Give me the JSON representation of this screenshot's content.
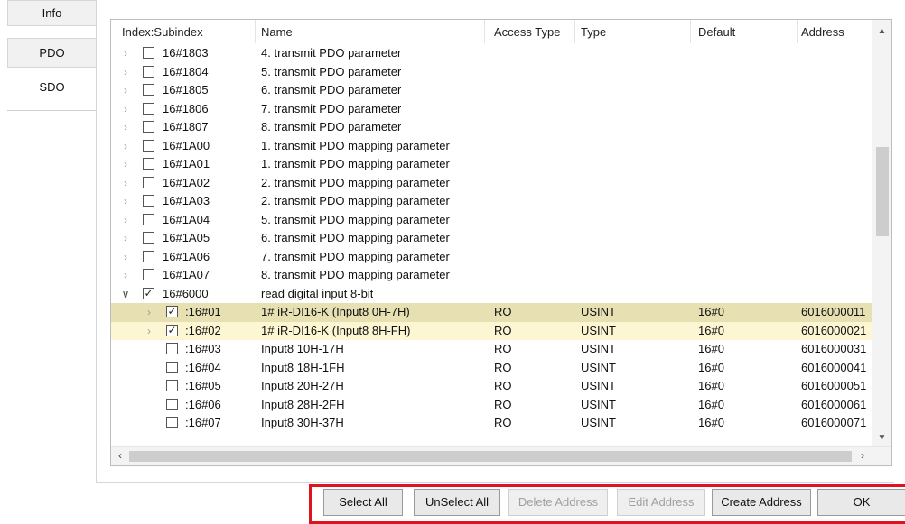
{
  "side_tabs": {
    "info": "Info",
    "pdo": "PDO",
    "sdo": "SDO"
  },
  "columns": {
    "index": "Index:Subindex",
    "name": "Name",
    "access": "Access Type",
    "type": "Type",
    "default": "Default",
    "address": "Address"
  },
  "rows": [
    {
      "index": "16#1803",
      "name": "4. transmit PDO parameter",
      "access": "",
      "type": "",
      "default": "",
      "address": ""
    },
    {
      "index": "16#1804",
      "name": "5. transmit PDO parameter",
      "access": "",
      "type": "",
      "default": "",
      "address": ""
    },
    {
      "index": "16#1805",
      "name": "6. transmit PDO parameter",
      "access": "",
      "type": "",
      "default": "",
      "address": ""
    },
    {
      "index": "16#1806",
      "name": "7. transmit PDO parameter",
      "access": "",
      "type": "",
      "default": "",
      "address": ""
    },
    {
      "index": "16#1807",
      "name": "8. transmit PDO parameter",
      "access": "",
      "type": "",
      "default": "",
      "address": ""
    },
    {
      "index": "16#1A00",
      "name": "1. transmit PDO mapping parameter",
      "access": "",
      "type": "",
      "default": "",
      "address": ""
    },
    {
      "index": "16#1A01",
      "name": "1. transmit PDO mapping parameter",
      "access": "",
      "type": "",
      "default": "",
      "address": ""
    },
    {
      "index": "16#1A02",
      "name": "2. transmit PDO mapping parameter",
      "access": "",
      "type": "",
      "default": "",
      "address": ""
    },
    {
      "index": "16#1A03",
      "name": "2. transmit PDO mapping parameter",
      "access": "",
      "type": "",
      "default": "",
      "address": ""
    },
    {
      "index": "16#1A04",
      "name": "5. transmit PDO mapping parameter",
      "access": "",
      "type": "",
      "default": "",
      "address": ""
    },
    {
      "index": "16#1A05",
      "name": "6. transmit PDO mapping parameter",
      "access": "",
      "type": "",
      "default": "",
      "address": ""
    },
    {
      "index": "16#1A06",
      "name": "7. transmit PDO mapping parameter",
      "access": "",
      "type": "",
      "default": "",
      "address": ""
    },
    {
      "index": "16#1A07",
      "name": "8. transmit PDO mapping parameter",
      "access": "",
      "type": "",
      "default": "",
      "address": ""
    },
    {
      "index": "16#6000",
      "name": "read digital input 8-bit",
      "access": "",
      "type": "",
      "default": "",
      "address": ""
    },
    {
      "index": ":16#01",
      "name": "1# iR-DI16-K (Input8 0H-7H)",
      "access": "RO",
      "type": "USINT",
      "default": "16#0",
      "address": "6016000011"
    },
    {
      "index": ":16#02",
      "name": "1# iR-DI16-K (Input8 8H-FH)",
      "access": "RO",
      "type": "USINT",
      "default": "16#0",
      "address": "6016000021"
    },
    {
      "index": ":16#03",
      "name": "Input8 10H-17H",
      "access": "RO",
      "type": "USINT",
      "default": "16#0",
      "address": "6016000031"
    },
    {
      "index": ":16#04",
      "name": "Input8 18H-1FH",
      "access": "RO",
      "type": "USINT",
      "default": "16#0",
      "address": "6016000041"
    },
    {
      "index": ":16#05",
      "name": "Input8 20H-27H",
      "access": "RO",
      "type": "USINT",
      "default": "16#0",
      "address": "6016000051"
    },
    {
      "index": ":16#06",
      "name": "Input8 28H-2FH",
      "access": "RO",
      "type": "USINT",
      "default": "16#0",
      "address": "6016000061"
    },
    {
      "index": ":16#07",
      "name": "Input8 30H-37H",
      "access": "RO",
      "type": "USINT",
      "default": "16#0",
      "address": "6016000071"
    }
  ],
  "buttons": {
    "select_all": "Select All",
    "unselect_all": "UnSelect All",
    "delete_address": "Delete Address",
    "edit_address": "Edit Address",
    "create_address": "Create Address",
    "ok": "OK"
  },
  "accent_colors": {
    "highlight_border": "#e0141e",
    "selected_row": "#e7e0b3",
    "hover_row": "#fdf6d3"
  }
}
